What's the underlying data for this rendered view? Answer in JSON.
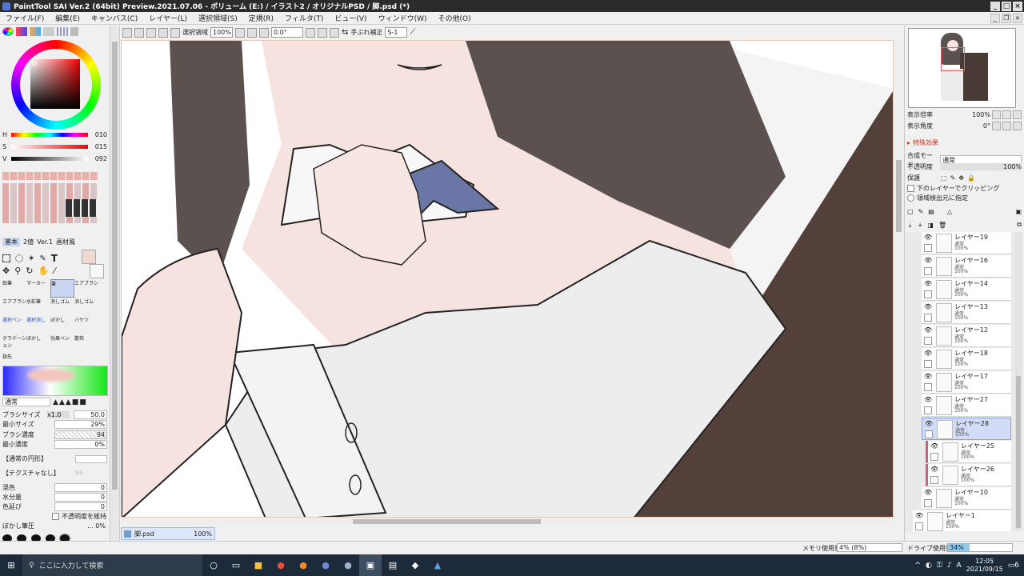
{
  "window": {
    "title": "PaintTool SAI Ver.2 (64bit) Preview.2021.07.06 - ボリューム (E:) / イラスト2 / オリジナルPSD / 脚.psd (*)"
  },
  "menu": [
    "ファイル(F)",
    "編集(E)",
    "キャンバス(C)",
    "レイヤー(L)",
    "選択領域(S)",
    "定規(R)",
    "フィルタ(T)",
    "ビュー(V)",
    "ウィンドウ(W)",
    "その他(O)"
  ],
  "toolbar": {
    "selection_label": "選択領域",
    "zoom": "100%",
    "angle": "0.0°",
    "stabilizer_label": "手ぶれ補正",
    "stabilizer_value": "S-1"
  },
  "color": {
    "sliders": [
      {
        "label": "H",
        "value": "010"
      },
      {
        "label": "S",
        "value": "015"
      },
      {
        "label": "V",
        "value": "092"
      }
    ],
    "current_color": "#efd9d4"
  },
  "tool_tabs": [
    "基本",
    "2値",
    "Ver.1",
    "画材風"
  ],
  "tools": [
    {
      "label": "鉛筆"
    },
    {
      "label": "マーカー"
    },
    {
      "label": "筆"
    },
    {
      "label": "エアブラシ"
    },
    {
      "label": "エアブラシ"
    },
    {
      "label": "水彩筆"
    },
    {
      "label": "消しゴム"
    },
    {
      "label": "消しゴム"
    },
    {
      "label": "選択ペン"
    },
    {
      "label": "選択消し"
    },
    {
      "label": "ぼかし"
    },
    {
      "label": "バケツ"
    },
    {
      "label": "グラデーション"
    },
    {
      "label": "ぼかし"
    },
    {
      "label": "効果ペン"
    },
    {
      "label": "散布"
    },
    {
      "label": "指先"
    }
  ],
  "brush": {
    "blend_mode": "通常",
    "size_label": "ブラシサイズ",
    "size_mult": "x1.0",
    "size_value": "50.0",
    "min_size_label": "最小サイズ",
    "min_size_value": "29%",
    "density_label": "ブラシ濃度",
    "density_value": "94",
    "min_density_label": "最小濃度",
    "min_density_value": "0%",
    "shape": "【通常の円形】",
    "texture": "【テクスチャなし】",
    "texture_value": "95",
    "mix_label": "混色",
    "mix_value": "0",
    "water_label": "水分量",
    "water_value": "0",
    "stretch_label": "色延び",
    "stretch_value": "0",
    "keep_opacity_label": "不透明度を維持",
    "blur_label": "ぼかし筆圧",
    "blur_value": "... 0%"
  },
  "navigator": {
    "zoom_label": "表示倍率",
    "zoom_value": "100%",
    "angle_label": "表示角度",
    "angle_value": "0°"
  },
  "layer_props": {
    "effect_label": "特殊効果",
    "blend_label": "合成モード",
    "blend_value": "通常",
    "opacity_label": "不透明度",
    "opacity_value": "100%",
    "protect_label": "保護",
    "clip_label": "下のレイヤーでクリッピング",
    "detect_label": "領域検出元に指定"
  },
  "layers": [
    {
      "name": "レイヤー19",
      "mode": "通常",
      "opacity": "100%"
    },
    {
      "name": "レイヤー16",
      "mode": "通常",
      "opacity": "100%"
    },
    {
      "name": "レイヤー14",
      "mode": "通常",
      "opacity": "100%"
    },
    {
      "name": "レイヤー13",
      "mode": "通常",
      "opacity": "100%"
    },
    {
      "name": "レイヤー12",
      "mode": "通常",
      "opacity": "100%"
    },
    {
      "name": "レイヤー18",
      "mode": "通常",
      "opacity": "100%"
    },
    {
      "name": "レイヤー17",
      "mode": "通常",
      "opacity": "100%"
    },
    {
      "name": "レイヤー27",
      "mode": "通常",
      "opacity": "100%"
    },
    {
      "name": "レイヤー28",
      "mode": "通常",
      "opacity": "100%"
    },
    {
      "name": "レイヤー25",
      "mode": "通常",
      "opacity": "100%"
    },
    {
      "name": "レイヤー26",
      "mode": "通常",
      "opacity": "100%"
    },
    {
      "name": "レイヤー10",
      "mode": "通常",
      "opacity": "100%"
    },
    {
      "name": "レイヤー1",
      "mode": "通常",
      "opacity": "100%"
    }
  ],
  "document": {
    "tab_name": "脚.psd",
    "tab_zoom": "100%"
  },
  "status": {
    "memory_label": "メモリ使用量",
    "memory_value": "4% (8%)",
    "drive_label": "ドライブ使用量",
    "drive_value": "34%"
  },
  "taskbar": {
    "search_placeholder": "ここに入力して検索",
    "time": "12:05",
    "date": "2021/09/15",
    "ime": "A",
    "notification_count": "6"
  }
}
